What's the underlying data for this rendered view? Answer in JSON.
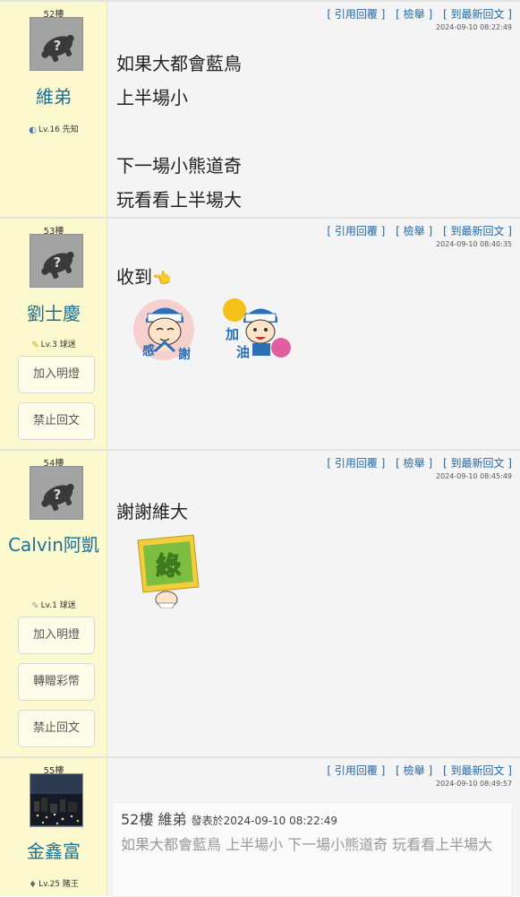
{
  "toolbar": {
    "quote_reply": "[ 引用回覆 ]",
    "report": "[ 檢舉 ]",
    "latest_reply": "[ 到最新回文 ]"
  },
  "posts": [
    {
      "floor": "52樓",
      "username": "維弟",
      "level": "Lv.16 先知",
      "level_icon": "moon-icon",
      "time": "2024-09-10 08:22:49",
      "lines": [
        "如果大都會藍鳥",
        "上半場小",
        "",
        "下一場小熊道奇",
        "玩看看上半場大"
      ]
    },
    {
      "floor": "53樓",
      "username": "劉士慶",
      "level": "Lv.3 球迷",
      "level_icon": "pencil-icon",
      "time": "2024-09-10 08:40:35",
      "text": "收到",
      "emoji": "👈",
      "stickers": [
        {
          "name": "thanks-sticker",
          "chars": [
            "感",
            "謝"
          ]
        },
        {
          "name": "cheer-sticker",
          "chars": [
            "加",
            "油"
          ]
        }
      ],
      "buttons": [
        "加入明燈",
        "禁止回文"
      ]
    },
    {
      "floor": "54樓",
      "username": "Calvin阿凱",
      "level": "Lv.1 球迷",
      "level_icon": "pencil-icon",
      "time": "2024-09-10 08:45:49",
      "text": "謝謝維大",
      "sticker_char": "綠",
      "buttons": [
        "加入明燈",
        "轉贈彩幣",
        "禁止回文"
      ]
    },
    {
      "floor": "55樓",
      "username": "金鑫富",
      "level": "Lv.25 賭王",
      "level_icon": "diamond-icon",
      "time": "2024-09-10 08:49:57",
      "quote": {
        "floor": "52樓",
        "user": "維弟",
        "meta": "發表於2024-09-10 08:22:49",
        "body": "如果大都會藍鳥 上半場小 下一場小熊道奇 玩看看上半場大"
      }
    }
  ]
}
